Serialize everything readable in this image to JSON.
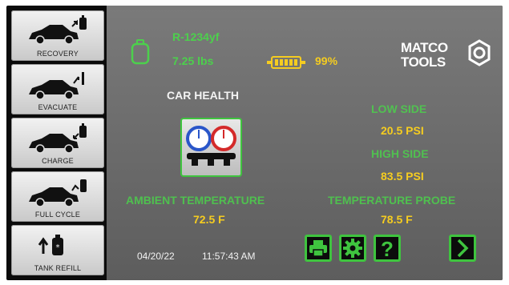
{
  "sidebar": {
    "items": [
      {
        "label": "RECOVERY",
        "icon": "car-recovery-icon"
      },
      {
        "label": "EVACUATE",
        "icon": "car-evacuate-icon"
      },
      {
        "label": "CHARGE",
        "icon": "car-charge-icon"
      },
      {
        "label": "FULL CYCLE",
        "icon": "car-full-cycle-icon"
      },
      {
        "label": "TANK REFILL",
        "icon": "tank-refill-icon"
      }
    ]
  },
  "tank": {
    "refrigerant": "R-1234yf",
    "weight": "7.25 lbs",
    "icon": "tank-icon"
  },
  "battery": {
    "percent": "99%",
    "icon": "battery-icon"
  },
  "brand": {
    "logo_text": "MATCO TOOLS"
  },
  "car_health": {
    "title": "CAR HEALTH",
    "icon": "manifold-gauge-icon"
  },
  "readings": {
    "low_side_label": "LOW SIDE",
    "low_side_value": "20.5 PSI",
    "high_side_label": "HIGH SIDE",
    "high_side_value": "83.5 PSI",
    "ambient_label": "AMBIENT TEMPERATURE",
    "ambient_value": "72.5 F",
    "probe_label": "TEMPERATURE PROBE",
    "probe_value": "78.5 F"
  },
  "status": {
    "date": "04/20/22",
    "time": "11:57:43 AM"
  },
  "toolbar": {
    "buttons": [
      "print-icon",
      "gear-icon",
      "help-icon",
      "next-icon"
    ]
  },
  "colors": {
    "accent_green": "#4cd04c",
    "value_yellow": "#f5cc20",
    "panel_gray": "#6b6b6b"
  }
}
